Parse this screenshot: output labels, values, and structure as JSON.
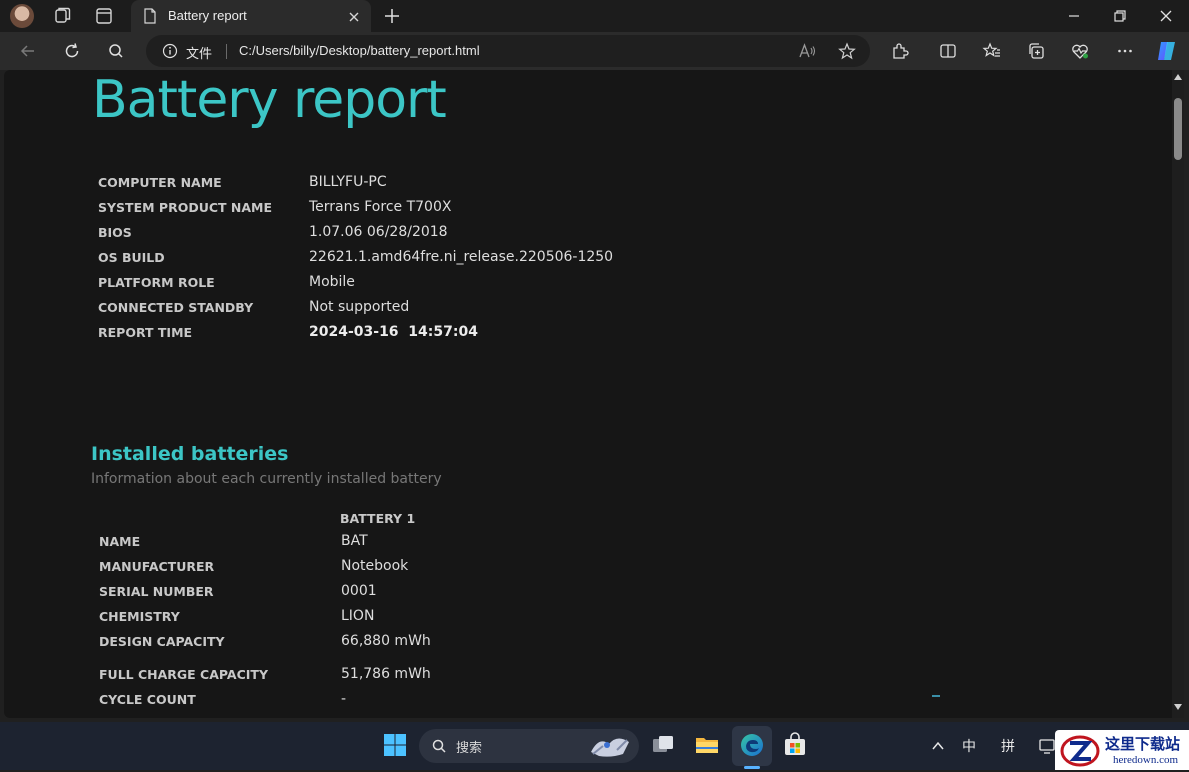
{
  "tab": {
    "title": "Battery report"
  },
  "address": {
    "scheme_label": "文件",
    "url": "C:/Users/billy/Desktop/battery_report.html"
  },
  "report": {
    "title": "Battery report",
    "system": [
      {
        "key": "COMPUTER NAME",
        "value": "BILLYFU-PC"
      },
      {
        "key": "SYSTEM PRODUCT NAME",
        "value": "Terrans Force T700X"
      },
      {
        "key": "BIOS",
        "value": "1.07.06 06/28/2018"
      },
      {
        "key": "OS BUILD",
        "value": "22621.1.amd64fre.ni_release.220506-1250"
      },
      {
        "key": "PLATFORM ROLE",
        "value": "Mobile"
      },
      {
        "key": "CONNECTED STANDBY",
        "value": "Not supported"
      },
      {
        "key": "REPORT TIME",
        "value": "2024-03-16  14:57:04"
      }
    ],
    "installed": {
      "heading": "Installed batteries",
      "subheading": "Information about each currently installed battery",
      "column": "BATTERY 1",
      "rows": [
        {
          "key": "NAME",
          "value": "BAT"
        },
        {
          "key": "MANUFACTURER",
          "value": "Notebook"
        },
        {
          "key": "SERIAL NUMBER",
          "value": "0001"
        },
        {
          "key": "CHEMISTRY",
          "value": "LION"
        },
        {
          "key": "DESIGN CAPACITY",
          "value": "66,880 mWh"
        },
        {
          "key": "FULL CHARGE CAPACITY",
          "value": "51,786 mWh"
        },
        {
          "key": "CYCLE COUNT",
          "value": "-"
        }
      ]
    }
  },
  "taskbar": {
    "search_placeholder": "搜索",
    "ime_lang": "中",
    "ime_mode": "拼"
  },
  "watermark": {
    "cn": "这里下载站",
    "en": "heredown.com"
  },
  "colors": {
    "accent": "#3cc6c6",
    "page_bg": "#161616",
    "browser_chrome": "#2b2b2b",
    "taskbar": "#1d2330"
  }
}
